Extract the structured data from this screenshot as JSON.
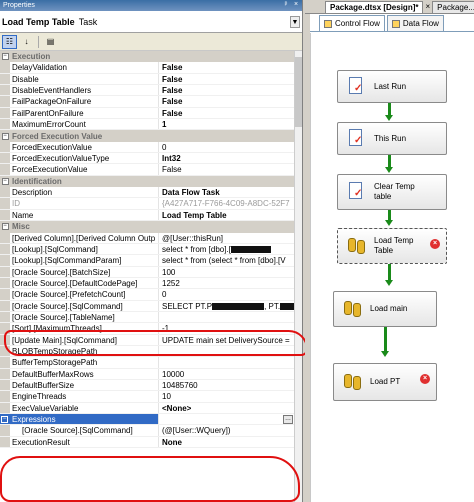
{
  "window": {
    "title": "Properties",
    "pin_glyph": "ᵖ",
    "close_glyph": "×"
  },
  "object_selector": {
    "name": "Load Temp Table",
    "type": "Task"
  },
  "toolbar": {
    "categorized_icon": "categorized-icon",
    "alphabetical_icon": "alphabetical-icon",
    "property_pages_icon": "property-pages-icon"
  },
  "categories": {
    "execution": "Execution",
    "forced": "Forced Execution Value",
    "identification": "Identification",
    "misc": "Misc",
    "expressions": "Expressions"
  },
  "properties": {
    "delay_validation": {
      "name": "DelayValidation",
      "value": "False"
    },
    "disable": {
      "name": "Disable",
      "value": "False"
    },
    "disable_event_handlers": {
      "name": "DisableEventHandlers",
      "value": "False"
    },
    "fail_package": {
      "name": "FailPackageOnFailure",
      "value": "False"
    },
    "fail_parent": {
      "name": "FailParentOnFailure",
      "value": "False"
    },
    "max_error": {
      "name": "MaximumErrorCount",
      "value": "1"
    },
    "forced_value": {
      "name": "ForcedExecutionValue",
      "value": "0"
    },
    "forced_type": {
      "name": "ForcedExecutionValueType",
      "value": "Int32"
    },
    "force_exec": {
      "name": "ForceExecutionValue",
      "value": "False"
    },
    "description": {
      "name": "Description",
      "value": "Data Flow Task"
    },
    "id": {
      "name": "ID",
      "value": "{A427A717-F766-4C09-A8DC-52F7"
    },
    "name": {
      "name": "Name",
      "value": "Load Temp Table"
    },
    "derived": {
      "name": "[Derived Column].[Derived Column Outp",
      "value": "@[User::thisRun]"
    },
    "lookup_sql": {
      "name": "[Lookup].[SqlCommand]",
      "value": "select * from [dbo].["
    },
    "lookup_param": {
      "name": "[Lookup].[SqlCommandParam]",
      "value": "select * from (select * from [dbo].[V"
    },
    "ora_batch": {
      "name": "[Oracle Source].[BatchSize]",
      "value": "100"
    },
    "ora_codepage": {
      "name": "[Oracle Source].[DefaultCodePage]",
      "value": "1252"
    },
    "ora_prefetch": {
      "name": "[Oracle Source].[PrefetchCount]",
      "value": "0"
    },
    "ora_sql": {
      "name": "[Oracle Source].[SqlCommand]",
      "value": "SELECT PT.P",
      "value_mid": ", PT."
    },
    "ora_table": {
      "name": "[Oracle Source].[TableName]",
      "value": ""
    },
    "sort_threads": {
      "name": "[Sort].[MaximumThreads]",
      "value": "-1"
    },
    "update_sql": {
      "name": "[Update Main].[SqlCommand]",
      "value": "UPDATE main set DeliverySource ="
    },
    "blob_path": {
      "name": "BLOBTempStoragePath",
      "value": ""
    },
    "buffer_path": {
      "name": "BufferTempStoragePath",
      "value": ""
    },
    "default_rows": {
      "name": "DefaultBufferMaxRows",
      "value": "10000"
    },
    "default_size": {
      "name": "DefaultBufferSize",
      "value": "10485760"
    },
    "engine_threads": {
      "name": "EngineThreads",
      "value": "10"
    },
    "execute_var": {
      "name": "ExecValueVariable",
      "value": "<None>"
    },
    "expr_ora_sql": {
      "name": "[Oracle Source].[SqlCommand]",
      "value": "(@[User::WQuery])"
    },
    "exec_result": {
      "name": "ExecutionResult",
      "value": "None"
    }
  },
  "designer": {
    "doc_tabs": [
      "Package.dtsx [Design]*",
      "Package..."
    ],
    "doc_close": "×",
    "design_tabs": [
      "Control Flow",
      "Data Flow"
    ],
    "tasks": [
      {
        "label": "Last Run"
      },
      {
        "label": "This Run"
      },
      {
        "label": "Clear Temp table"
      },
      {
        "label": "Load Temp Table"
      },
      {
        "label": "Load main"
      },
      {
        "label": "Load PT"
      }
    ]
  }
}
